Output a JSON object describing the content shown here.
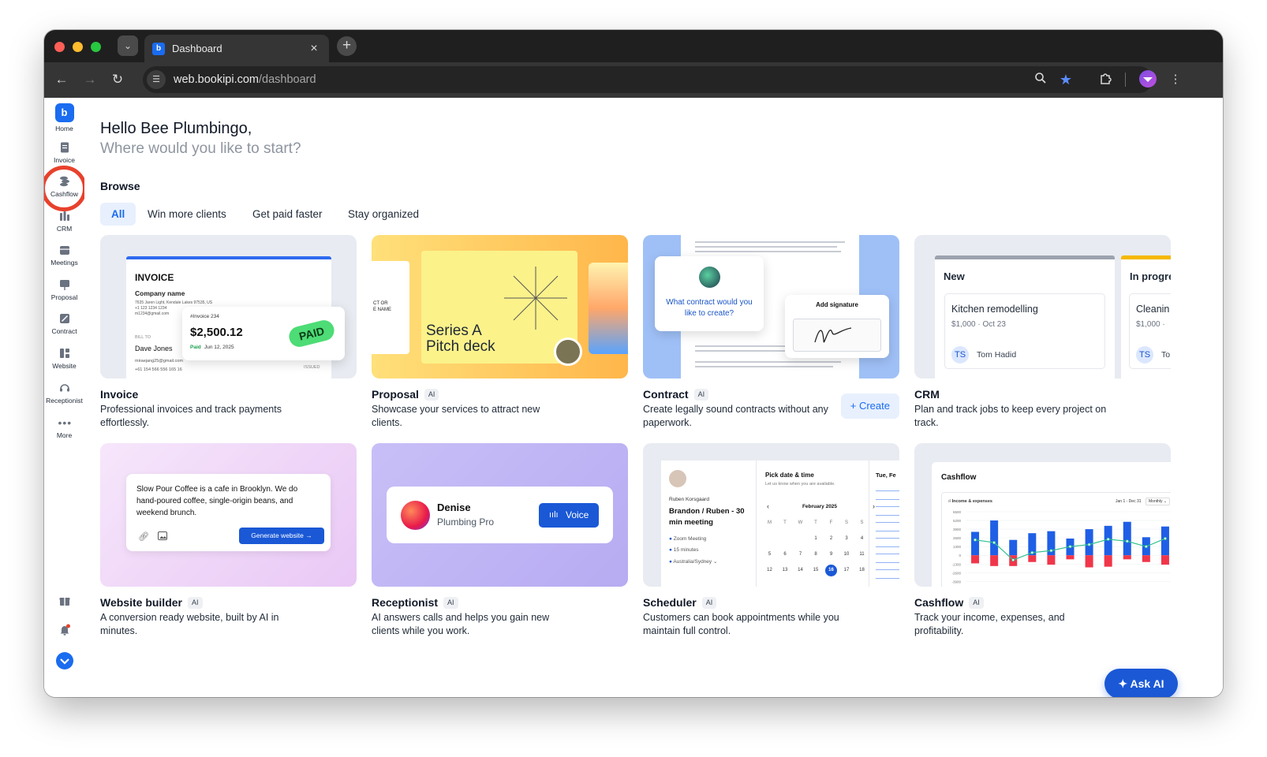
{
  "browser": {
    "tab_title": "Dashboard",
    "url_domain": "web.bookipi.com",
    "url_path": "/dashboard",
    "colors": {
      "close": "#ff5f57",
      "minimize": "#febc2e",
      "zoom": "#28c840"
    }
  },
  "sidebar": {
    "items": [
      {
        "label": "Home",
        "icon": "home-logo-icon"
      },
      {
        "label": "Invoice",
        "icon": "invoice-icon"
      },
      {
        "label": "Cashflow",
        "icon": "cashflow-icon"
      },
      {
        "label": "CRM",
        "icon": "crm-icon"
      },
      {
        "label": "Meetings",
        "icon": "meetings-icon"
      },
      {
        "label": "Proposal",
        "icon": "proposal-icon"
      },
      {
        "label": "Contract",
        "icon": "contract-icon"
      },
      {
        "label": "Website",
        "icon": "website-icon"
      },
      {
        "label": "Receptionist",
        "icon": "receptionist-icon"
      },
      {
        "label": "More",
        "icon": "more-icon"
      }
    ],
    "highlight_color": "#e8412c"
  },
  "header": {
    "greeting": "Hello Bee Plumbingo,",
    "subtitle": "Where would you like to start?"
  },
  "browse": {
    "title": "Browse",
    "filters": [
      "All",
      "Win more clients",
      "Get paid faster",
      "Stay organized"
    ],
    "active_filter": "All"
  },
  "cards": [
    {
      "title": "Invoice",
      "ai": "",
      "desc": "Professional invoices and track payments effortlessly."
    },
    {
      "title": "Proposal",
      "ai": "AI",
      "desc": "Showcase your services to attract new clients."
    },
    {
      "title": "Contract",
      "ai": "AI",
      "desc": "Create legally sound contracts without any paperwork."
    },
    {
      "title": "CRM",
      "ai": "",
      "desc": "Plan and track jobs to keep every project on track."
    },
    {
      "title": "Website builder",
      "ai": "AI",
      "desc": "A conversion ready website, built by AI in minutes."
    },
    {
      "title": "Receptionist",
      "ai": "AI",
      "desc": "AI answers calls and helps you gain new clients while you work."
    },
    {
      "title": "Scheduler",
      "ai": "AI",
      "desc": "Customers can book appointments while you maintain full control."
    },
    {
      "title": "Cashflow",
      "ai": "AI",
      "desc": "Track your income, expenses, and profitability."
    }
  ],
  "contract_create": "+ Create",
  "previews": {
    "invoice": {
      "heading": "INVOICE",
      "company": "Company name",
      "address": "7635 Jaren Light, Kendale Lakes 97535, US",
      "phone": "+1 123 1234 1234",
      "email": "m1234@gmail.com",
      "bill_to": "BILL TO",
      "client": "Dave Jones",
      "client_email": "miraejang25@gmail.com",
      "client_phone": "+61 154 566 556 165 16",
      "issued": "ISSUED",
      "number": "#Invoice 234",
      "amount": "$2,500.12",
      "paid": "Paid",
      "date": "Jun 12, 2025",
      "stamp": "PAID"
    },
    "proposal": {
      "title_line1": "Series A",
      "title_line2": "Pitch deck",
      "side_text": "CT OR\nE NAME"
    },
    "contract": {
      "question": "What contract would you like to create?",
      "sign": "Add signature"
    },
    "crm": {
      "col1": "New",
      "col2": "In progre",
      "job1": "Kitchen remodelling",
      "job1_meta": "$1,000 · Oct 23",
      "job1_initials": "TS",
      "job1_owner": "Tom Hadid",
      "job2": "Cleanin",
      "job2_meta": "$1,000 ·",
      "job2_initials": "TS",
      "job2_owner": "To"
    },
    "website": {
      "prompt": "Slow Pour Coffee is a cafe in Brooklyn. We do hand-poured coffee, single-origin beans, and weekend brunch.",
      "button": "Generate website →"
    },
    "receptionist": {
      "name": "Denise",
      "company": "Plumbing Pro",
      "button": "Voice"
    },
    "scheduler": {
      "host": "Ruben Korsgaard",
      "meeting": "Brandon / Ruben - 30 min meeting",
      "opt1": "Zoom Meeting",
      "opt2": "15 minutes",
      "opt3": "Australia/Sydney",
      "pick": "Pick date & time",
      "pick_sub": "Let us know when you are available.",
      "month": "February 2025",
      "weekdays": [
        "M",
        "T",
        "W",
        "T",
        "F",
        "S",
        "S"
      ],
      "row1": [
        "",
        "",
        "",
        "1",
        "2",
        "3",
        "4"
      ],
      "row2": [
        "5",
        "6",
        "7",
        "8",
        "9",
        "10",
        "11"
      ],
      "row3": [
        "12",
        "13",
        "14",
        "15",
        "16",
        "17",
        "18"
      ],
      "selected": "16",
      "side_day": "Tue, Fe"
    },
    "cashflow": {
      "title": "Cashflow",
      "chart_title": "Income & expenses",
      "range": "Jan 1 - Dec 31",
      "period": "Monthly"
    }
  },
  "chart_data": {
    "type": "bar",
    "title": "Income & expenses",
    "ylim": [
      -4800,
      6500
    ],
    "yticks": [
      "6500",
      "5200",
      "3900",
      "2600",
      "1300",
      "0",
      "-1300",
      "-2600",
      "-3900",
      "-4800"
    ],
    "series": [
      {
        "name": "",
        "values": [
          3500,
          5200,
          2300,
          3300,
          3600,
          2500,
          3900,
          4400,
          5000,
          2700,
          4300
        ]
      },
      {
        "name": "",
        "values": [
          -1200,
          -1600,
          -1600,
          -1000,
          -1400,
          -600,
          -1800,
          -1700,
          -600,
          -1000,
          -1400
        ]
      },
      {
        "name": "",
        "values": [
          2300,
          1900,
          -700,
          400,
          700,
          1300,
          1600,
          2400,
          2100,
          1300,
          2500
        ]
      }
    ],
    "colors": {
      "income": "#1f5fe6",
      "expense": "#f0364a",
      "net": "#2fc28d"
    }
  },
  "ask_ai": "Ask AI"
}
